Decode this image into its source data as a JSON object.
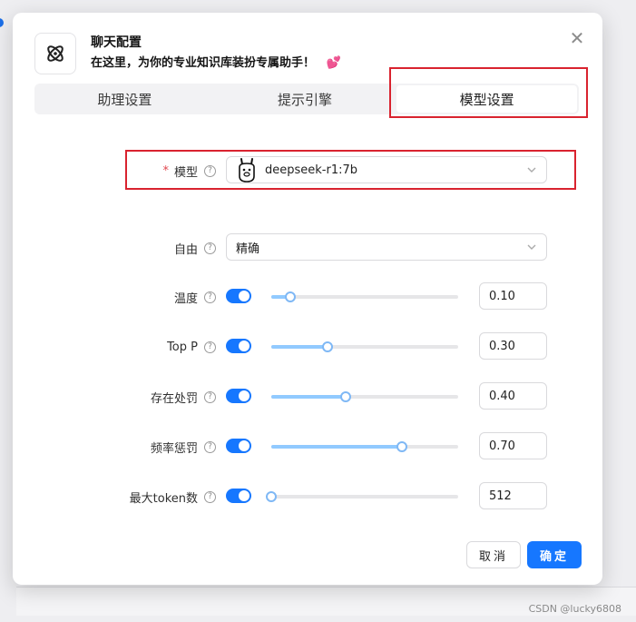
{
  "dialog": {
    "title": "聊天配置",
    "subtitle": "在这里，为你的专业知识库装扮专属助手！",
    "subtitle_emoji": "💕",
    "close_symbol": "✕"
  },
  "tabs": [
    {
      "label": "助理设置",
      "active": false
    },
    {
      "label": "提示引擎",
      "active": false
    },
    {
      "label": "模型设置",
      "active": true
    }
  ],
  "form": {
    "model": {
      "required_mark": "*",
      "label": "模型",
      "value": "deepseek-r1:7b",
      "icon": "llama-icon"
    },
    "freedom": {
      "label": "自由",
      "value": "精确"
    },
    "temperature": {
      "label": "温度",
      "enabled": true,
      "value_text": "0.10",
      "level": 0.1
    },
    "top_p": {
      "label": "Top P",
      "enabled": true,
      "value_text": "0.30",
      "level": 0.3
    },
    "presence_penalty": {
      "label": "存在处罚",
      "enabled": true,
      "value_text": "0.40",
      "level": 0.4
    },
    "frequency_penalty": {
      "label": "频率惩罚",
      "enabled": true,
      "value_text": "0.70",
      "level": 0.7
    },
    "max_tokens": {
      "label": "最大token数",
      "enabled": true,
      "value_text": "512",
      "level": 0.0
    }
  },
  "footer": {
    "cancel_label": "取消",
    "ok_label": "确定"
  },
  "watermark": "CSDN @lucky6808",
  "colors": {
    "primary": "#1677ff",
    "highlight_border": "#d9232f",
    "required": "#e0474f",
    "slider_fill": "#91caff"
  }
}
